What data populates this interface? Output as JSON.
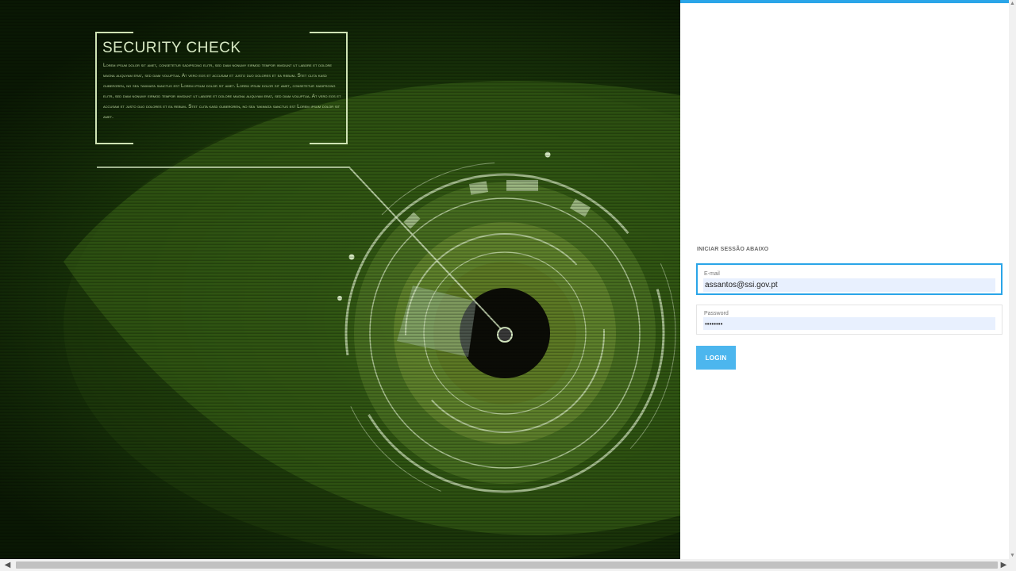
{
  "hero": {
    "title": "SECURITY CHECK",
    "body": "Lorem ipsum dolor sit amet, consetetur sadipscing elitr, sed diam nonumy eirmod tempor invidunt ut labore et dolore magna aliquyam erat, sed diam voluptua. At vero eos et accusam et justo duo dolores et ea rebum. Stet clita kasd gubergren, no sea takimata sanctus est Lorem ipsum dolor sit amet. Lorem ipsum dolor sit amet, consetetur sadipscing elitr, sed diam nonumy eirmod tempor invidunt ut labore et dolore magna aliquyam erat, sed diam voluptua. At vero eos et accusam et justo duo dolores et ea rebum. Stet clita kasd gubergren, no sea takimata sanctus est Lorem ipsum dolor sit amet."
  },
  "login": {
    "section_label": "INICIAR SESSÃO ABAIXO",
    "email_label": "E-mail",
    "email_value": "assantos@ssi.gov.pt",
    "password_label": "Password",
    "password_value": "••••••••",
    "button_label": "LOGIN"
  },
  "colors": {
    "accent": "#2aa5e8",
    "button": "#4cb6ee",
    "autofill": "#e8f0fe"
  },
  "icons": {
    "scroll_left": "◀",
    "scroll_right": "▶",
    "scroll_up": "▲",
    "scroll_down": "▼"
  }
}
